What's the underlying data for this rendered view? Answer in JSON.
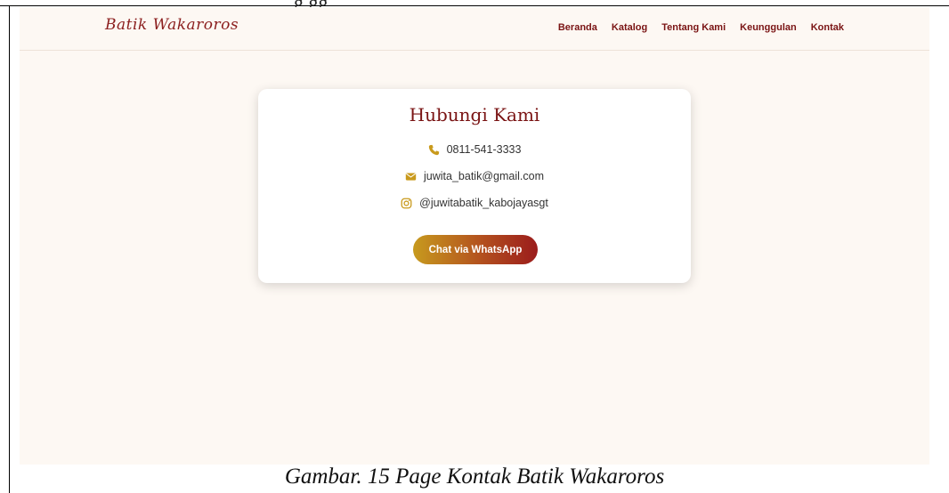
{
  "document": {
    "top_clipped_text": "g     gg",
    "caption": "Gambar. 15 Page Kontak Batik Wakaroros"
  },
  "navbar": {
    "logo": "Batik Wakaroros",
    "links": [
      {
        "label": "Beranda"
      },
      {
        "label": "Katalog"
      },
      {
        "label": "Tentang Kami"
      },
      {
        "label": "Keunggulan"
      },
      {
        "label": "Kontak"
      }
    ]
  },
  "contact": {
    "title": "Hubungi Kami",
    "phone": "0811-541-3333",
    "email": "juwita_batik@gmail.com",
    "instagram": "@juwitabatik_kabojayasgt",
    "button_label": "Chat via WhatsApp",
    "icons": {
      "phone": "phone-icon",
      "email": "envelope-icon",
      "instagram": "instagram-icon"
    }
  },
  "colors": {
    "accent": "#7a1414",
    "icon_gold": "#c99a1c",
    "background": "#fdf8f3"
  }
}
